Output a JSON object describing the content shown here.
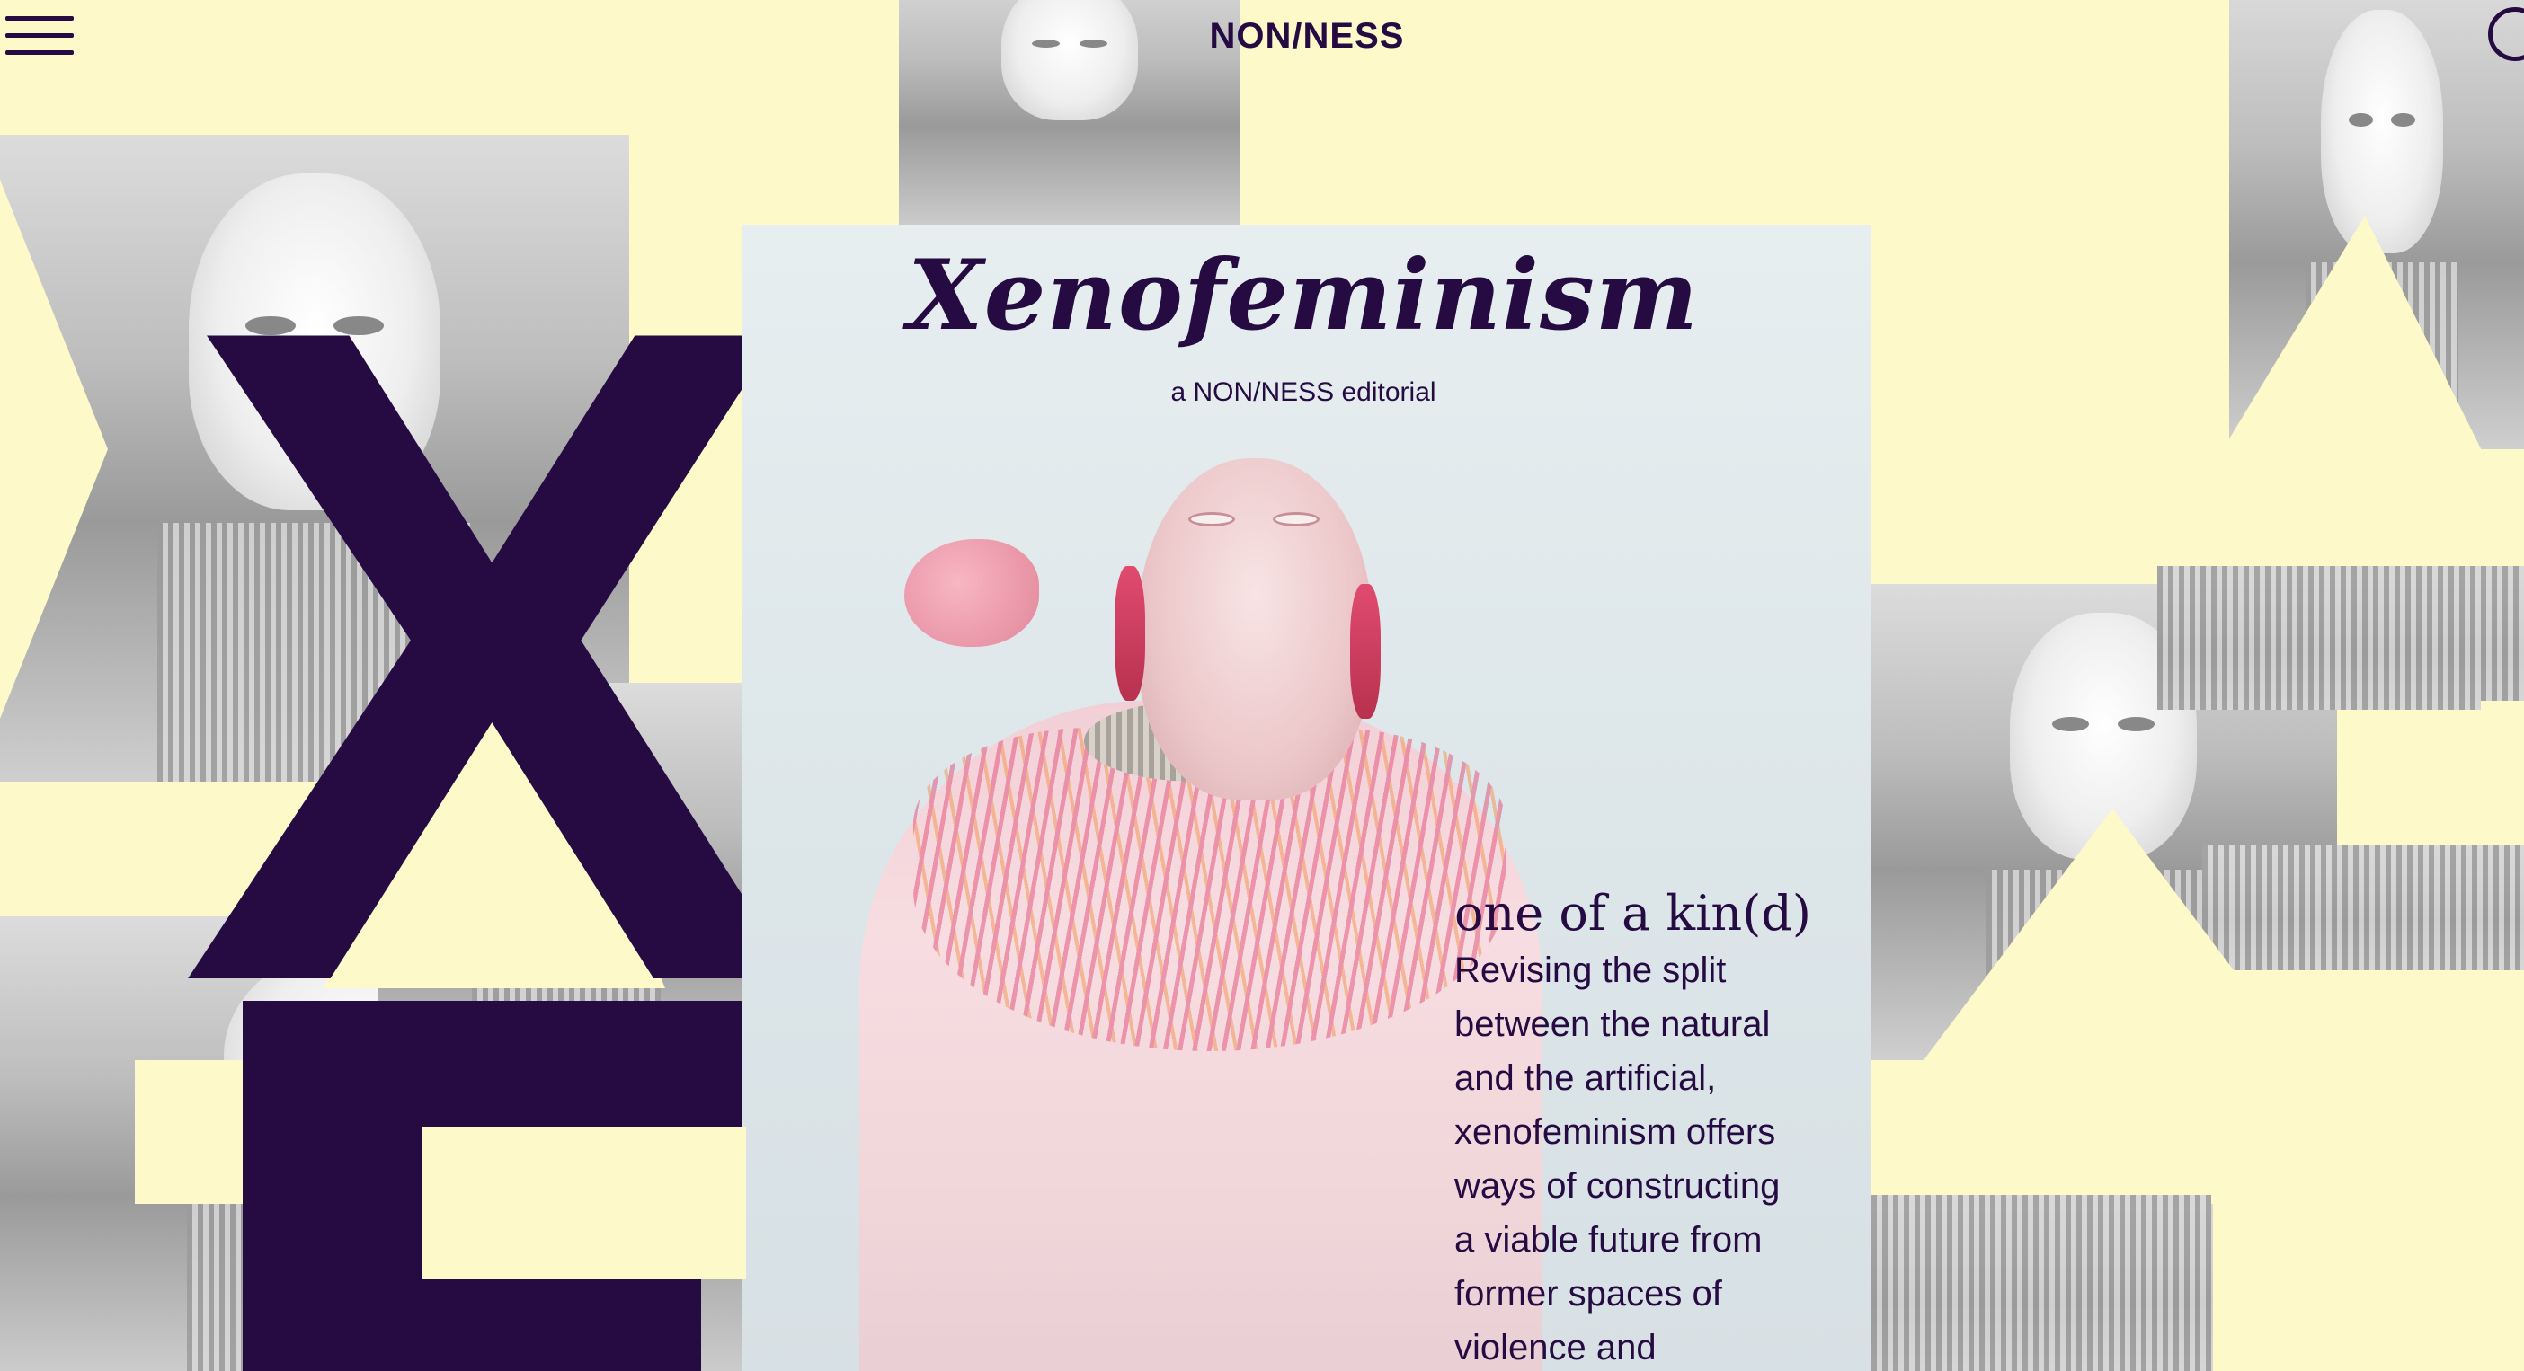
{
  "header": {
    "logo": "NON/NESS",
    "menu_icon": "hamburger-menu-icon",
    "search_icon": "search-icon"
  },
  "hero": {
    "big_letters": [
      "X",
      "E"
    ],
    "title": "Xenofeminism",
    "subtitle": "a NON/NESS editorial"
  },
  "article": {
    "heading": "one of a kin(d)",
    "body_lines": [
      "Revising the split",
      "between the natural",
      "and the artificial,",
      "xenofeminism offers",
      "ways of constructing",
      "a viable future from",
      "former spaces of",
      "violence and"
    ]
  },
  "colors": {
    "background": "#fdf9c9",
    "accent_purple": "#260b43"
  }
}
